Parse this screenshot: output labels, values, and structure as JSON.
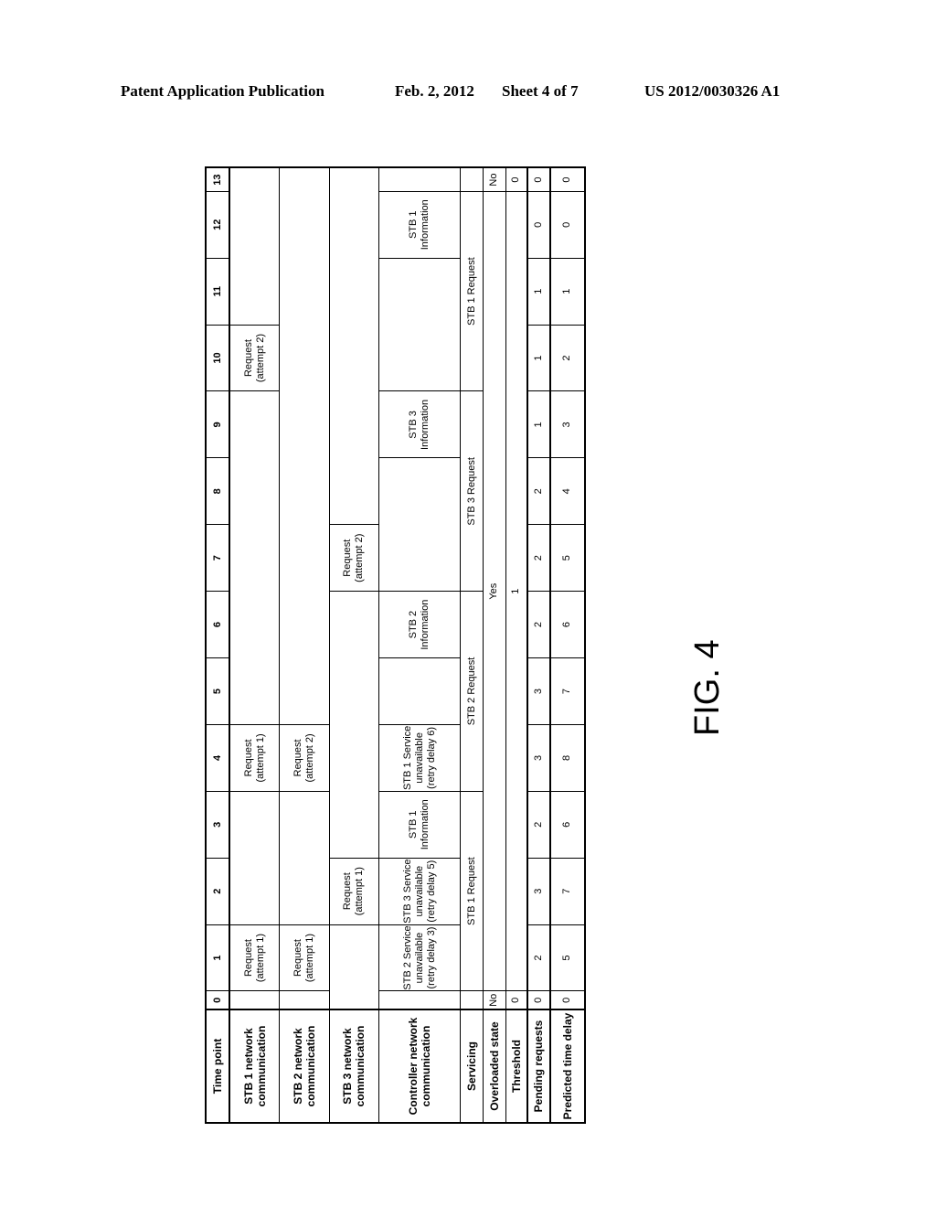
{
  "header": {
    "publication": "Patent Application Publication",
    "date": "Feb. 2, 2012",
    "sheet": "Sheet 4 of 7",
    "number": "US 2012/0030326 A1"
  },
  "figure_label": "FIG. 4",
  "table": {
    "row_headers": {
      "time_point": "Time point",
      "stb1": "STB 1 network communication",
      "stb2": "STB 2 network communication",
      "stb3": "STB 3 network communication",
      "controller": "Controller network communication",
      "servicing": "Servicing",
      "overloaded": "Overloaded state",
      "threshold": "Threshold",
      "pending": "Pending requests",
      "predicted": "Predicted time delay"
    },
    "time_points": [
      "0",
      "1",
      "2",
      "3",
      "4",
      "5",
      "6",
      "7",
      "8",
      "9",
      "10",
      "11",
      "12",
      "13"
    ],
    "stb1": {
      "t1": "Request (attempt 1)",
      "t4": "Request (attempt 1)",
      "t10": "Request (attempt 2)"
    },
    "stb2": {
      "t1": "Request (attempt 1)",
      "t4": "Request (attempt 2)"
    },
    "stb3": {
      "t2": "Request (attempt 1)",
      "t7": "Request (attempt 2)"
    },
    "controller": {
      "t1": "STB 2 Service unavailable (retry delay 3)",
      "t2": "STB 3 Service unavailable (retry delay 5)",
      "t3": "STB 1 Information",
      "t4": "STB 1 Service unavailable (retry delay 6)",
      "t6": "STB 2 Information",
      "t9": "STB 3 Information",
      "t12": "STB 1 Information"
    },
    "servicing": {
      "span1": "STB 1 Request",
      "span2": "STB 2 Request",
      "span3": "STB 3 Request",
      "span4": "STB 1 Request"
    },
    "overloaded": {
      "t0": "No",
      "t1_12": "Yes",
      "t13": "No"
    },
    "threshold": {
      "t0": "0",
      "t1_12": "1",
      "t13": "0"
    },
    "pending_requests": [
      "0",
      "2",
      "3",
      "2",
      "3",
      "3",
      "2",
      "2",
      "2",
      "1",
      "1",
      "1",
      "0",
      "0"
    ],
    "predicted_time_delay": [
      "0",
      "5",
      "7",
      "6",
      "8",
      "7",
      "6",
      "5",
      "4",
      "3",
      "2",
      "1",
      "0",
      "0"
    ]
  }
}
